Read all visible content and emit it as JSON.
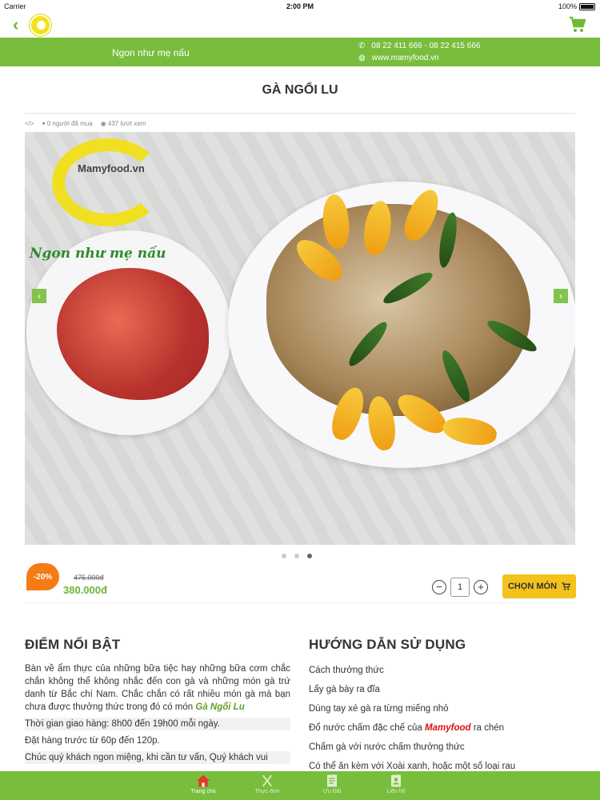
{
  "status_bar": {
    "carrier": "Carrier",
    "time": "2:00 PM",
    "battery": "100%"
  },
  "top_bar": {
    "slogan": "Ngon như mẹ nấu",
    "phone": "08 22 411 666 - 08 22 415 666",
    "website": "www.mamyfood.vn"
  },
  "product": {
    "title": "GÀ NGỔI LU",
    "buyers": "0 người đã mua",
    "views": "437 lượt xem",
    "image_logo_text": "Mamyfood.vn",
    "image_logo_slogan": "Ngon như mẹ nấu",
    "carousel_count": 3,
    "carousel_active": 3,
    "discount": "-20%",
    "price_old": "475.000đ",
    "price_new": "380.000đ",
    "quantity": "1",
    "order_label": "CHỌN MÓN"
  },
  "highlights": {
    "title": "ĐIỂM NỔI BẬT",
    "intro": "Bàn về ẩm thực của những bữa tiệc hay những bữa cơm chắc chắn không thể không nhắc đến con gà và những món gà trứ danh từ Bắc chí Nam. Chắc chắn có rất nhiều món gà mà bạn chưa được thưởng thức trong đó có món",
    "dish_name": "Gà Ngổi Lu",
    "delivery": "Thời gian giao hàng: 8h00 đến 19h00 mỗi ngày.",
    "preorder": "Đặt hàng trước từ 60p đến 120p.",
    "closing": "Chúc quý khách ngon miệng, khi cần tư vấn, Quý khách vui"
  },
  "guide": {
    "title": "HƯỚNG DẪN SỬ DỤNG",
    "heading": "Cách thưởng thức",
    "step1": "Lấy gà bày ra đĩa",
    "step2": "Dùng tay xé gà ra từng miếng nhỏ",
    "step3_before": "Đổ nước chấm đặc chế của",
    "step3_brand": "Mamyfood",
    "step3_after": "ra chén",
    "step4": "Chấm gà với nước chấm thưởng thức",
    "step5": "Có thể ăn kèm với Xoài xanh, hoặc một số loại rau"
  },
  "tab_bar": [
    {
      "label": "Trang chủ",
      "icon": "home-icon"
    },
    {
      "label": "Thực đơn",
      "icon": "utensils-icon"
    },
    {
      "label": "Ưu Đãi",
      "icon": "document-icon"
    },
    {
      "label": "Liên hệ",
      "icon": "contact-icon"
    }
  ],
  "colors": {
    "brand_green": "#78be3c",
    "order_yellow": "#f4c21a",
    "discount_orange": "#f47b16",
    "price_green": "#6fb536"
  }
}
